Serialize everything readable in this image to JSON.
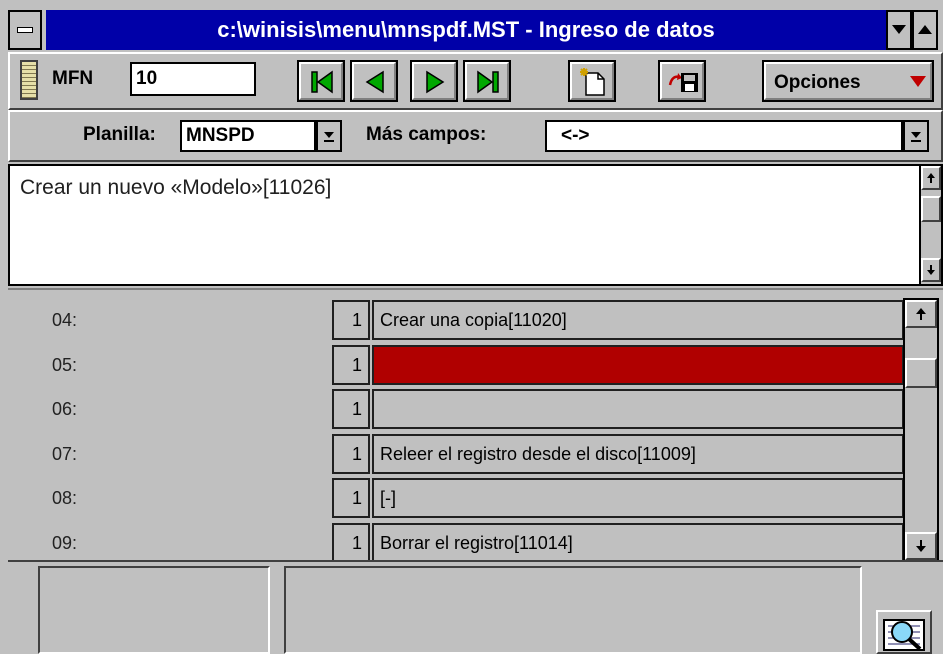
{
  "window": {
    "title": "c:\\winisis\\menu\\mnspdf.MST - Ingreso de datos",
    "system_menu_icon": "minus-icon",
    "dropdown_icon": "triangle-down-icon"
  },
  "toolbar": {
    "mfn_label": "MFN",
    "mfn_value": "10",
    "first_icon": "first-record-icon",
    "prev_icon": "previous-record-icon",
    "next_icon": "next-record-icon",
    "last_icon": "last-record-icon",
    "new_icon": "new-record-icon",
    "save_icon": "save-record-icon",
    "options_label": "Opciones",
    "options_icon": "triangle-down-icon"
  },
  "form": {
    "planilla_label": "Planilla:",
    "planilla_value": "MNSPD",
    "mas_campos_label": "Más campos:",
    "mas_campos_value": "<->"
  },
  "editor": {
    "text": "Crear un nuevo «Modelo»[11026]"
  },
  "fields": [
    {
      "tag": "04:",
      "occ": "1",
      "value": "Crear una copia[11020]",
      "selected": false
    },
    {
      "tag": "05:",
      "occ": "1",
      "value": "",
      "selected": true
    },
    {
      "tag": "06:",
      "occ": "1",
      "value": "",
      "selected": false
    },
    {
      "tag": "07:",
      "occ": "1",
      "value": "Releer el registro desde el disco[11009]",
      "selected": false
    },
    {
      "tag": "08:",
      "occ": "1",
      "value": "[-]",
      "selected": false
    },
    {
      "tag": "09:",
      "occ": "1",
      "value": "Borrar el registro[11014]",
      "selected": false
    }
  ],
  "colors": {
    "title_bar": "#0000a8",
    "selected_field": "#b00000",
    "nav_arrow": "#00a800",
    "options_arrow": "#c00000"
  },
  "status": {
    "search_icon": "magnifier-icon"
  }
}
